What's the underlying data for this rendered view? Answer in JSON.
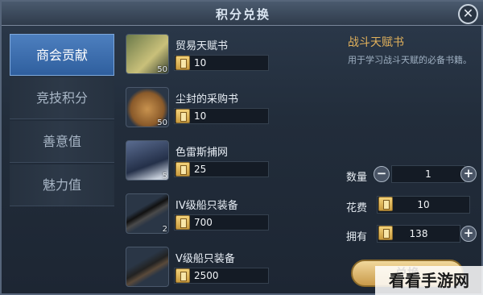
{
  "window": {
    "title": "积分兑换"
  },
  "tabs": [
    {
      "label": "商会贡献",
      "active": true
    },
    {
      "label": "竞技积分",
      "active": false
    },
    {
      "label": "善意值",
      "active": false
    },
    {
      "label": "魅力值",
      "active": false
    }
  ],
  "items": [
    {
      "name": "贸易天赋书",
      "price": "10",
      "qty": "50"
    },
    {
      "name": "尘封的采购书",
      "price": "10",
      "qty": "50"
    },
    {
      "name": "色雷斯捕网",
      "price": "25",
      "qty": "5"
    },
    {
      "name": "IV级船只装备",
      "price": "700",
      "qty": "2"
    },
    {
      "name": "V级船只装备",
      "price": "2500",
      "qty": ""
    }
  ],
  "detail": {
    "title": "战斗天赋书",
    "description": "用于学习战斗天赋的必备书籍。",
    "quantity_label": "数量",
    "quantity": "1",
    "cost_label": "花费",
    "cost": "10",
    "owned_label": "拥有",
    "owned": "138",
    "buy_label": "兑换"
  },
  "watermark": "看看手游网",
  "icons": {
    "close": "close-icon",
    "coin": "coin-icon",
    "minus": "minus-icon",
    "plus": "plus-icon"
  },
  "colors": {
    "active_tab": "#3a6fb0",
    "detail_title": "#e1b15c"
  }
}
